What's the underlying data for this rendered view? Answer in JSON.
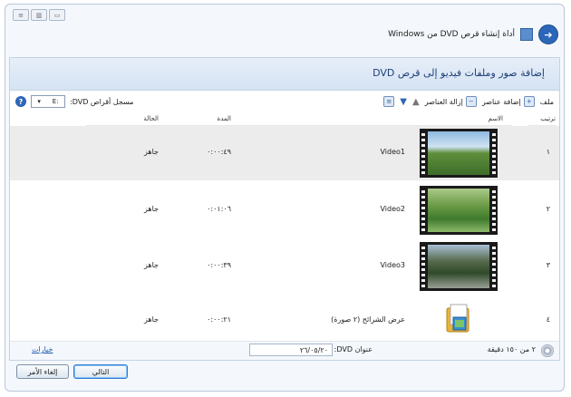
{
  "window": {
    "title": "أداة إنشاء قرص DVD من Windows",
    "controls": [
      "≡",
      "▥",
      "▭"
    ]
  },
  "heading": "إضافة صور وملفات فيديو إلى قرص DVD",
  "toolbar": {
    "file_label": "ملف",
    "add_items_label": "إضافة عناصر",
    "remove_items_label": "إزالة العناصر",
    "burner_label": "مسجل أقراص DVD:",
    "burner_value": "E:"
  },
  "columns": {
    "order": "ترتيب",
    "name": "الاسم",
    "duration": "المدة",
    "status": "الحالة"
  },
  "rows": [
    {
      "order": "١",
      "name": "Video1",
      "duration": "٠:٠٠:٤٩",
      "status": "جاهز"
    },
    {
      "order": "٢",
      "name": "Video2",
      "duration": "٠:٠١:٠٦",
      "status": "جاهز"
    },
    {
      "order": "٣",
      "name": "Video3",
      "duration": "٠:٠٠:٣٩",
      "status": "جاهز"
    },
    {
      "order": "٤",
      "name": "عرض الشرائح (٢ صورة)",
      "duration": "٠:٠٠:٢١",
      "status": "جاهز"
    }
  ],
  "status": {
    "minutes": "٢ من ١٥٠ دقيقة",
    "dvd_title_label": "عنوان DVD:",
    "dvd_title_value": "٢٦/٠٥/٢٠",
    "options_label": "خيارات"
  },
  "buttons": {
    "next": "التالي",
    "cancel": "إلغاء الأمر"
  },
  "colors": {
    "accent": "#2c66b8",
    "header_band": "#dbe6f4",
    "selected_row": "#ececec"
  }
}
